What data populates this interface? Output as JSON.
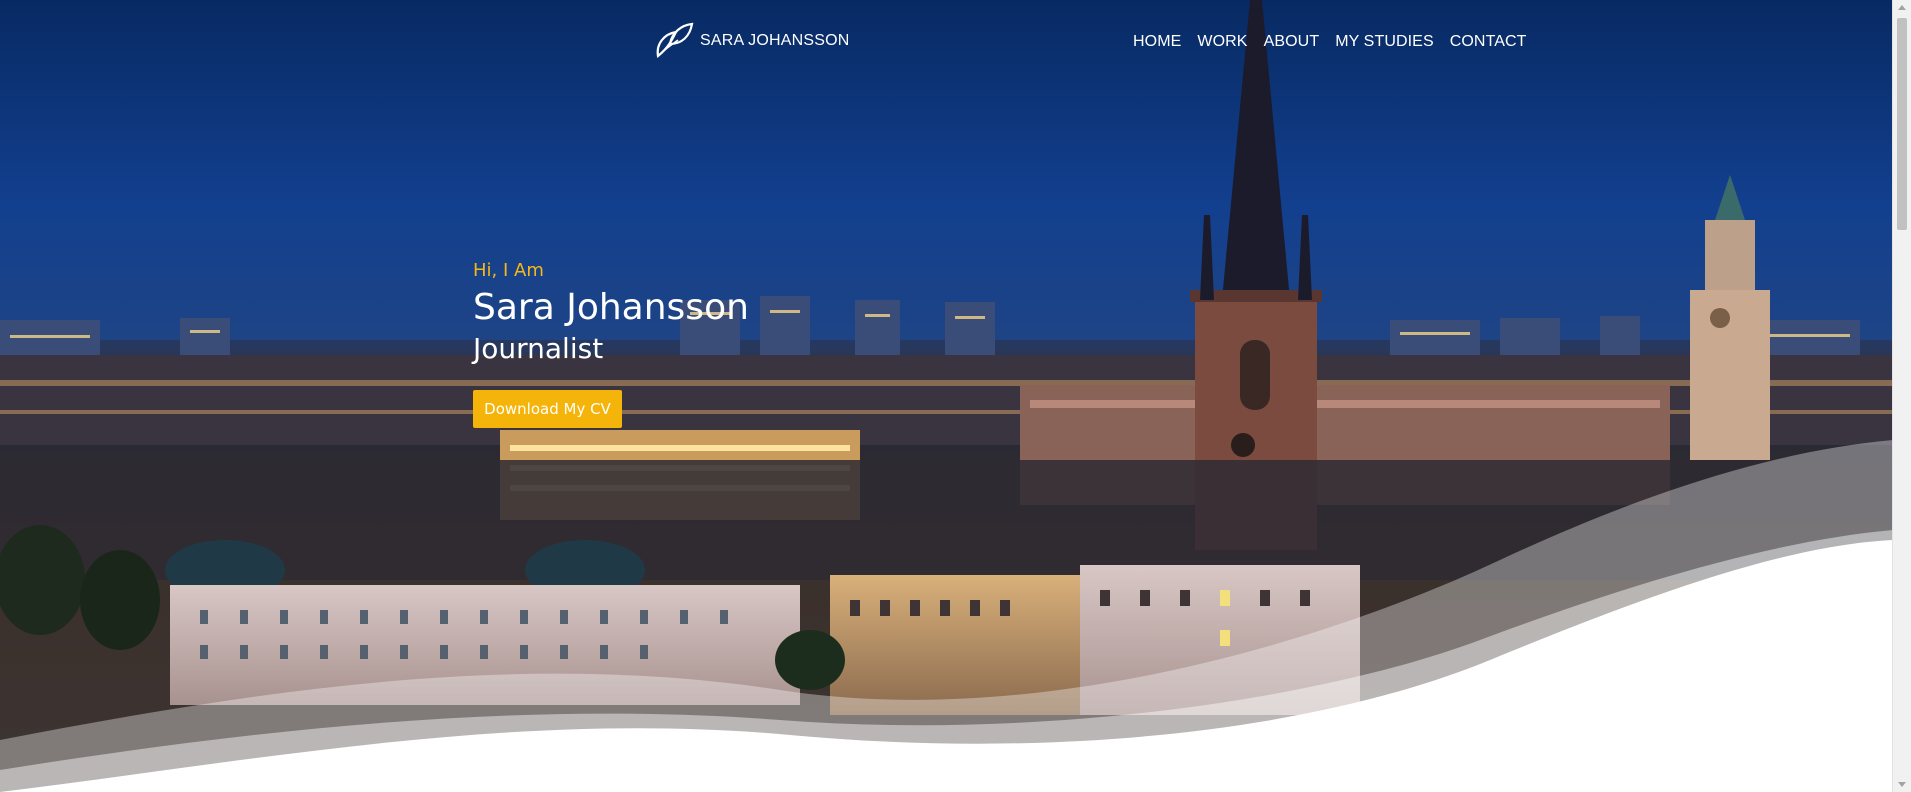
{
  "header": {
    "brand_name": "SARA JOHANSSON",
    "logo_icon": "leaf-icon",
    "nav": {
      "home": "HOME",
      "work": "WORK",
      "about": "ABOUT",
      "my_studies": "MY STUDIES",
      "contact": "CONTACT"
    }
  },
  "hero": {
    "greeting": "Hi, I Am",
    "name": "Sara Johansson",
    "role": "Journalist",
    "cta_label": "Download My CV",
    "background": "stockholm-city-night-photo"
  },
  "colors": {
    "accent": "#f5b40a",
    "greeting": "#f5b817",
    "sky": "#0e3a84",
    "wave": "#ffffff"
  }
}
